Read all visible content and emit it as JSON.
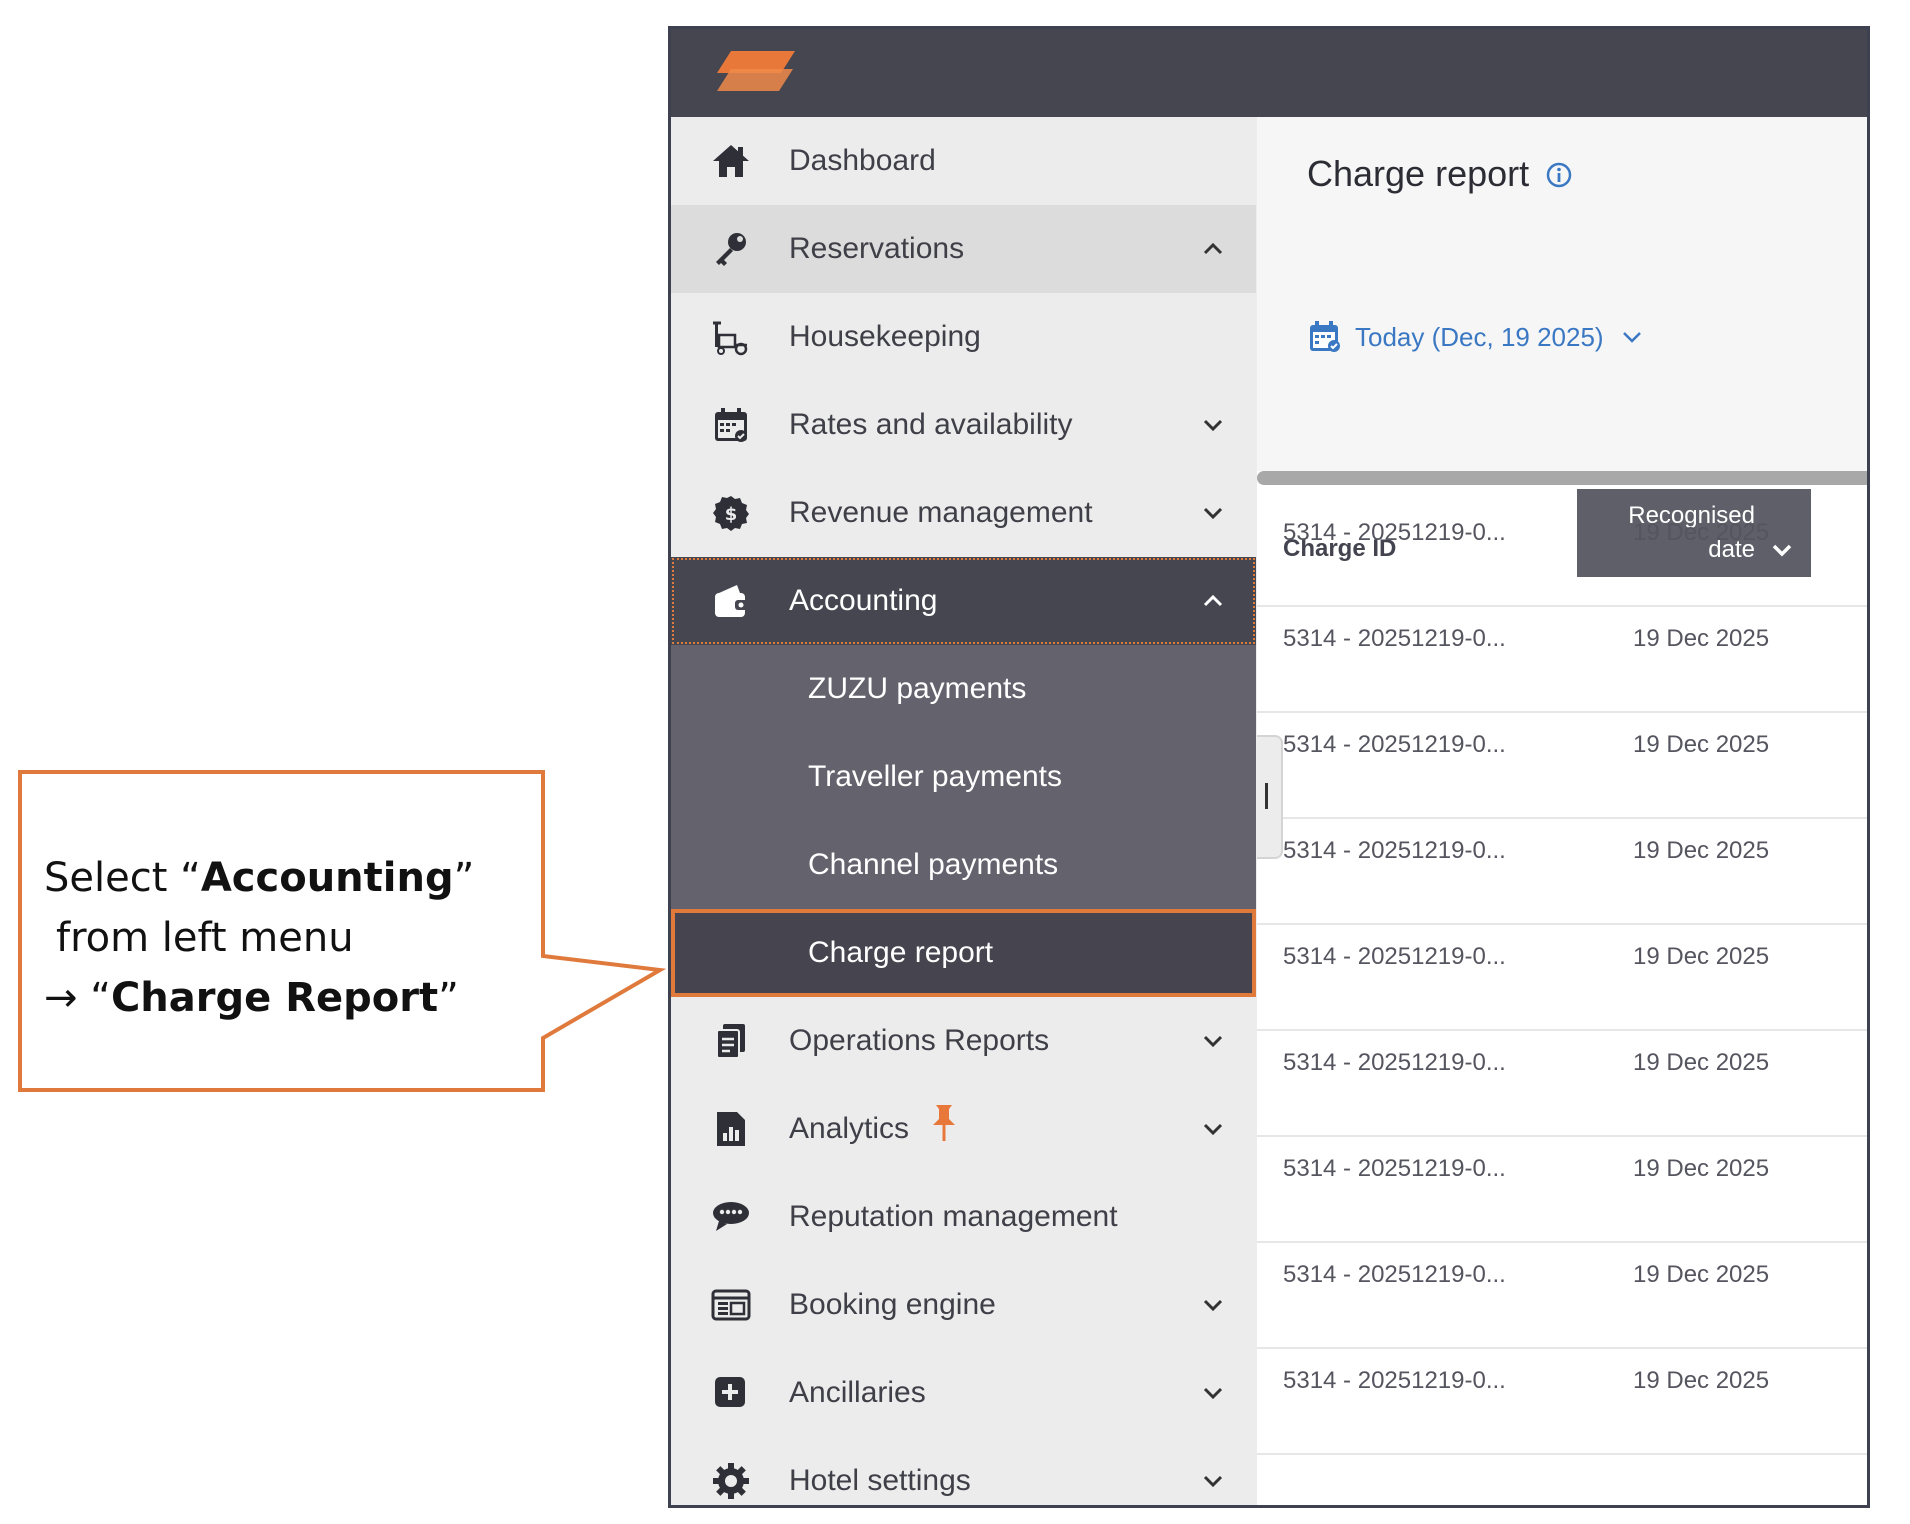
{
  "colors": {
    "accent": "#e07a3c",
    "topbar": "#464650",
    "link_blue": "#3b78c3",
    "submenu_bg": "#64636d"
  },
  "logo": {
    "icon": "layered-logo-icon"
  },
  "sidebar": {
    "items": [
      {
        "label": "Dashboard",
        "icon": "home-icon"
      },
      {
        "label": "Reservations",
        "icon": "key-icon",
        "chevron": "up"
      },
      {
        "label": "Housekeeping",
        "icon": "housekeeping-cart-icon"
      },
      {
        "label": "Rates and availability",
        "icon": "calendar-icon",
        "chevron": "down"
      },
      {
        "label": "Revenue management",
        "icon": "dollar-coin-icon",
        "chevron": "down"
      },
      {
        "label": "Accounting",
        "icon": "wallet-icon",
        "chevron": "up"
      },
      {
        "label": "Operations Reports",
        "icon": "reports-icon",
        "chevron": "down"
      },
      {
        "label": "Analytics",
        "icon": "analytics-icon",
        "chevron": "down",
        "badge_icon": "pin-icon"
      },
      {
        "label": "Reputation management",
        "icon": "chat-bubbles-icon"
      },
      {
        "label": "Booking engine",
        "icon": "booking-window-icon",
        "chevron": "down"
      },
      {
        "label": "Ancillaries",
        "icon": "plus-square-icon",
        "chevron": "down"
      },
      {
        "label": "Hotel settings",
        "icon": "settings-gear-icon",
        "chevron": "down"
      }
    ],
    "accounting_submenu": [
      {
        "label": "ZUZU payments"
      },
      {
        "label": "Traveller payments"
      },
      {
        "label": "Channel payments"
      },
      {
        "label": "Charge report"
      }
    ]
  },
  "main": {
    "title": "Charge report",
    "date_filter": "Today (Dec, 19 2025)",
    "table": {
      "columns": [
        "Charge ID",
        "Recognised date"
      ],
      "rows": [
        {
          "id": "5314 - 20251219-0...",
          "date": "19 Dec 2025"
        },
        {
          "id": "5314 - 20251219-0...",
          "date": "19 Dec 2025"
        },
        {
          "id": "5314 - 20251219-0...",
          "date": "19 Dec 2025"
        },
        {
          "id": "5314 - 20251219-0...",
          "date": "19 Dec 2025"
        },
        {
          "id": "5314 - 20251219-0...",
          "date": "19 Dec 2025"
        },
        {
          "id": "5314 - 20251219-0...",
          "date": "19 Dec 2025"
        },
        {
          "id": "5314 - 20251219-0...",
          "date": "19 Dec 2025"
        },
        {
          "id": "5314 - 20251219-0...",
          "date": "19 Dec 2025"
        },
        {
          "id": "5314 - 20251219-0...",
          "date": "19 Dec 2025"
        }
      ]
    }
  },
  "callout": {
    "line1_prefix": "Select “",
    "line1_bold": "Accounting",
    "line1_suffix": "”",
    "line2": "from left menu",
    "line3_prefix": "→ “",
    "line3_bold": "Charge Report",
    "line3_suffix": "”"
  }
}
